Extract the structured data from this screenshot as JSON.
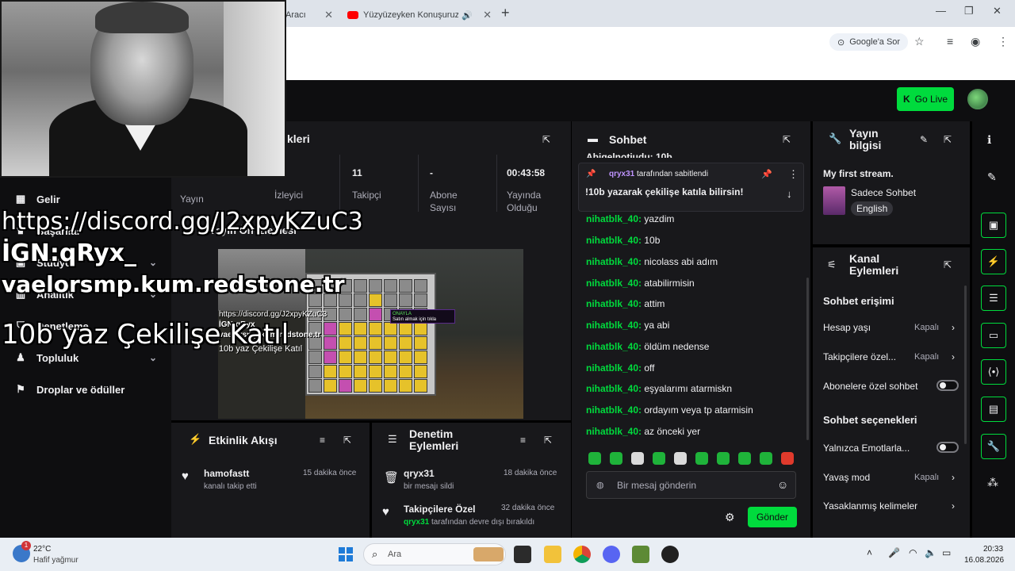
{
  "browser": {
    "tabs": [
      {
        "title": "Aracı"
      },
      {
        "title": "Yüzyüzeyken Konuşuruz - S"
      }
    ],
    "google_button": "Google'a Sor"
  },
  "topbar": {
    "go_live": "Go Live"
  },
  "overlay": {
    "discord": "https://discord.gg/J2xpyKZuC3",
    "ign": "İGN:qRyx_",
    "server": "vaelorsmp.kum.redstone.tr",
    "giveaway": "10b yaz  Çekilişe Katıl"
  },
  "sidebar": {
    "items": [
      {
        "label": "Gelir",
        "icon": "revenue-icon"
      },
      {
        "label": "Başarılar",
        "icon": "trophy-icon"
      },
      {
        "label": "Stüdyo",
        "icon": "studio-icon"
      },
      {
        "label": "Analitik",
        "icon": "analytics-icon"
      },
      {
        "label": "Denetleme",
        "icon": "shield-icon"
      },
      {
        "label": "Topluluk",
        "icon": "community-icon"
      },
      {
        "label": "Droplar ve ödüller",
        "icon": "drops-icon"
      }
    ]
  },
  "stats": {
    "title_fragment": "kleri",
    "items": [
      {
        "label": "Yayın",
        "value": ""
      },
      {
        "label": "İzleyici",
        "value": ""
      },
      {
        "label": "Takipçi",
        "value": "11"
      },
      {
        "label": "Abone\nSayısı",
        "value": "-"
      },
      {
        "label": "Yayında\nOlduğu",
        "value": "00:43:58"
      }
    ]
  },
  "preview": {
    "title": "Yayın Ön İzlemesi",
    "tooltip_top": "ONAYLA",
    "tooltip_text": "Satın almak için tıkla",
    "small_lines": [
      "https://discord.gg/J2xpyKZuC3",
      "İGN:qRyx_",
      "vaelorsmp.kum.redstone.tr",
      "10b yaz  Çekilişe Katıl"
    ]
  },
  "events": {
    "title": "Etkinlik Akışı",
    "items": [
      {
        "name": "hamofastt",
        "sub": "kanalı takip etti",
        "time": "15 dakika önce"
      }
    ]
  },
  "modlog": {
    "title": "Denetim Eylemleri",
    "items": [
      {
        "name": "qryx31",
        "sub": "bir mesajı sildi",
        "time": "18 dakika önce"
      },
      {
        "name": "Takipçilere Özel",
        "sub_user": "qryx31",
        "sub": "tarafından devre dışı bırakıldı",
        "time": "32 dakika önce"
      }
    ]
  },
  "chat": {
    "title": "Sohbet",
    "cut_line": "Abigelnotjudu: 10b",
    "pinned_by": "qryx31",
    "pinned_suffix": "tarafından sabitlendi",
    "pinned_text": "!10b yazarak çekilişe katıla bilirsin!",
    "messages": [
      {
        "user": "nihatblk_40:",
        "text": "yazdim"
      },
      {
        "user": "nihatblk_40:",
        "text": "10b"
      },
      {
        "user": "nihatblk_40:",
        "text": "nicolass abi adım"
      },
      {
        "user": "nihatblk_40:",
        "text": "atabilirmisin"
      },
      {
        "user": "nihatblk_40:",
        "text": "attim"
      },
      {
        "user": "nihatblk_40:",
        "text": "ya abi"
      },
      {
        "user": "nihatblk_40:",
        "text": "öldüm nedense"
      },
      {
        "user": "nihatblk_40:",
        "text": "off"
      },
      {
        "user": "nihatblk_40:",
        "text": "eşyalarımı atarmiskn"
      },
      {
        "user": "nihatblk_40:",
        "text": "ordayım veya tp atarmisin"
      },
      {
        "user": "nihatblk_40:",
        "text": "az önceki yer"
      }
    ],
    "input_placeholder": "Bir mesaj gönderin",
    "send": "Gönder"
  },
  "stream_info": {
    "title": "Yayın bilgisi",
    "stream_title": "My first stream.",
    "category": "Sadece Sohbet",
    "tag": "English"
  },
  "actions": {
    "title": "Kanal Eylemleri",
    "sections": [
      {
        "title": "Sohbet erişimi"
      },
      {
        "title": "Sohbet seçenekleri"
      }
    ],
    "rows": [
      {
        "label": "Hesap yaşı",
        "value": "Kapalı"
      },
      {
        "label": "Takipçilere özel...",
        "value": "Kapalı"
      },
      {
        "label": "Abonelere özel sohbet",
        "value": ""
      },
      {
        "label": "Yalnızca Emotlarla...",
        "value": ""
      },
      {
        "label": "Yavaş mod",
        "value": "Kapalı"
      },
      {
        "label": "Yasaklanmış kelimeler",
        "value": ""
      }
    ]
  },
  "taskbar": {
    "weather_temp": "22°C",
    "weather_desc": "Hafif yağmur",
    "search": "Ara",
    "time": "20:33",
    "date": "16.08.2026",
    "badge": "1"
  }
}
